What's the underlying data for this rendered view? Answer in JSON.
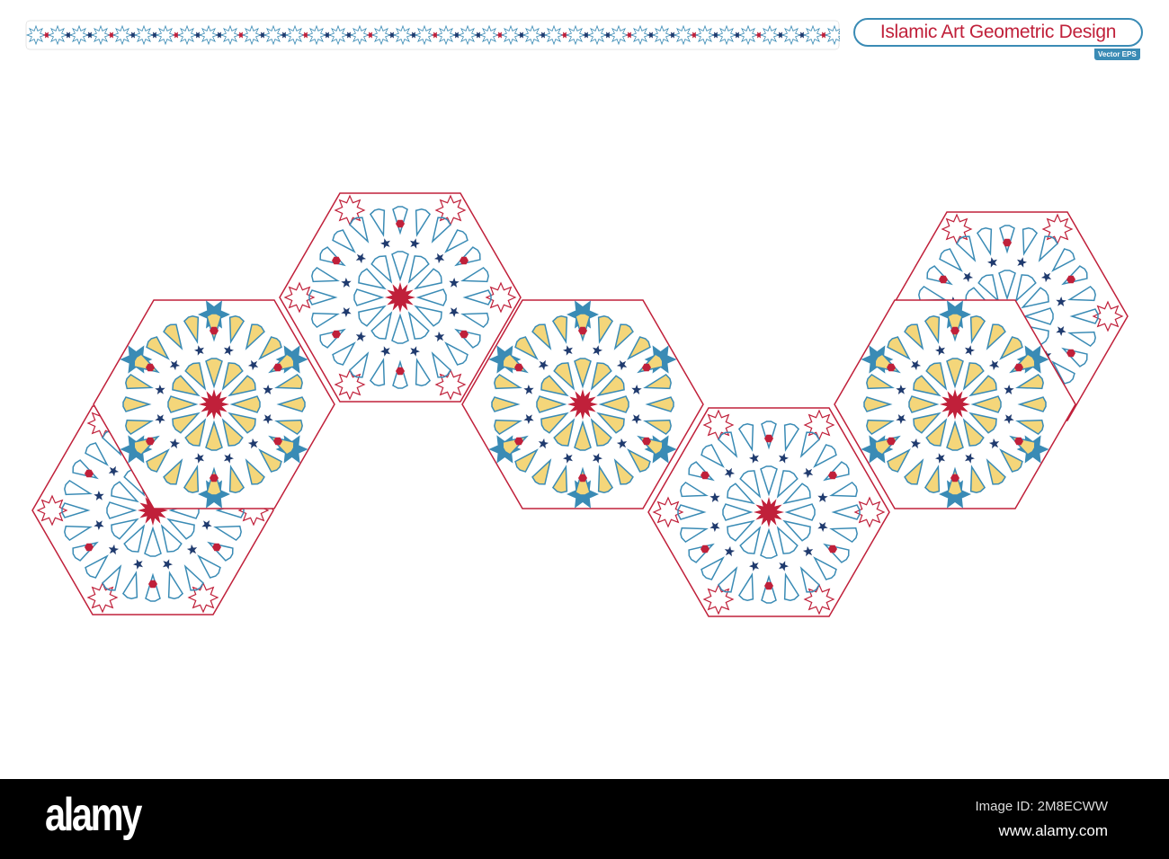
{
  "header": {
    "title": "Islamic Art Geometric Design",
    "badge": "Vector EPS"
  },
  "colors": {
    "red": "#c0203a",
    "blue": "#3a8bb5",
    "navy": "#1f3a6e",
    "yellow": "#f4d67a"
  },
  "footer": {
    "logo": "alamy",
    "image_id": "Image ID: 2M8ECWW",
    "url": "www.alamy.com"
  }
}
